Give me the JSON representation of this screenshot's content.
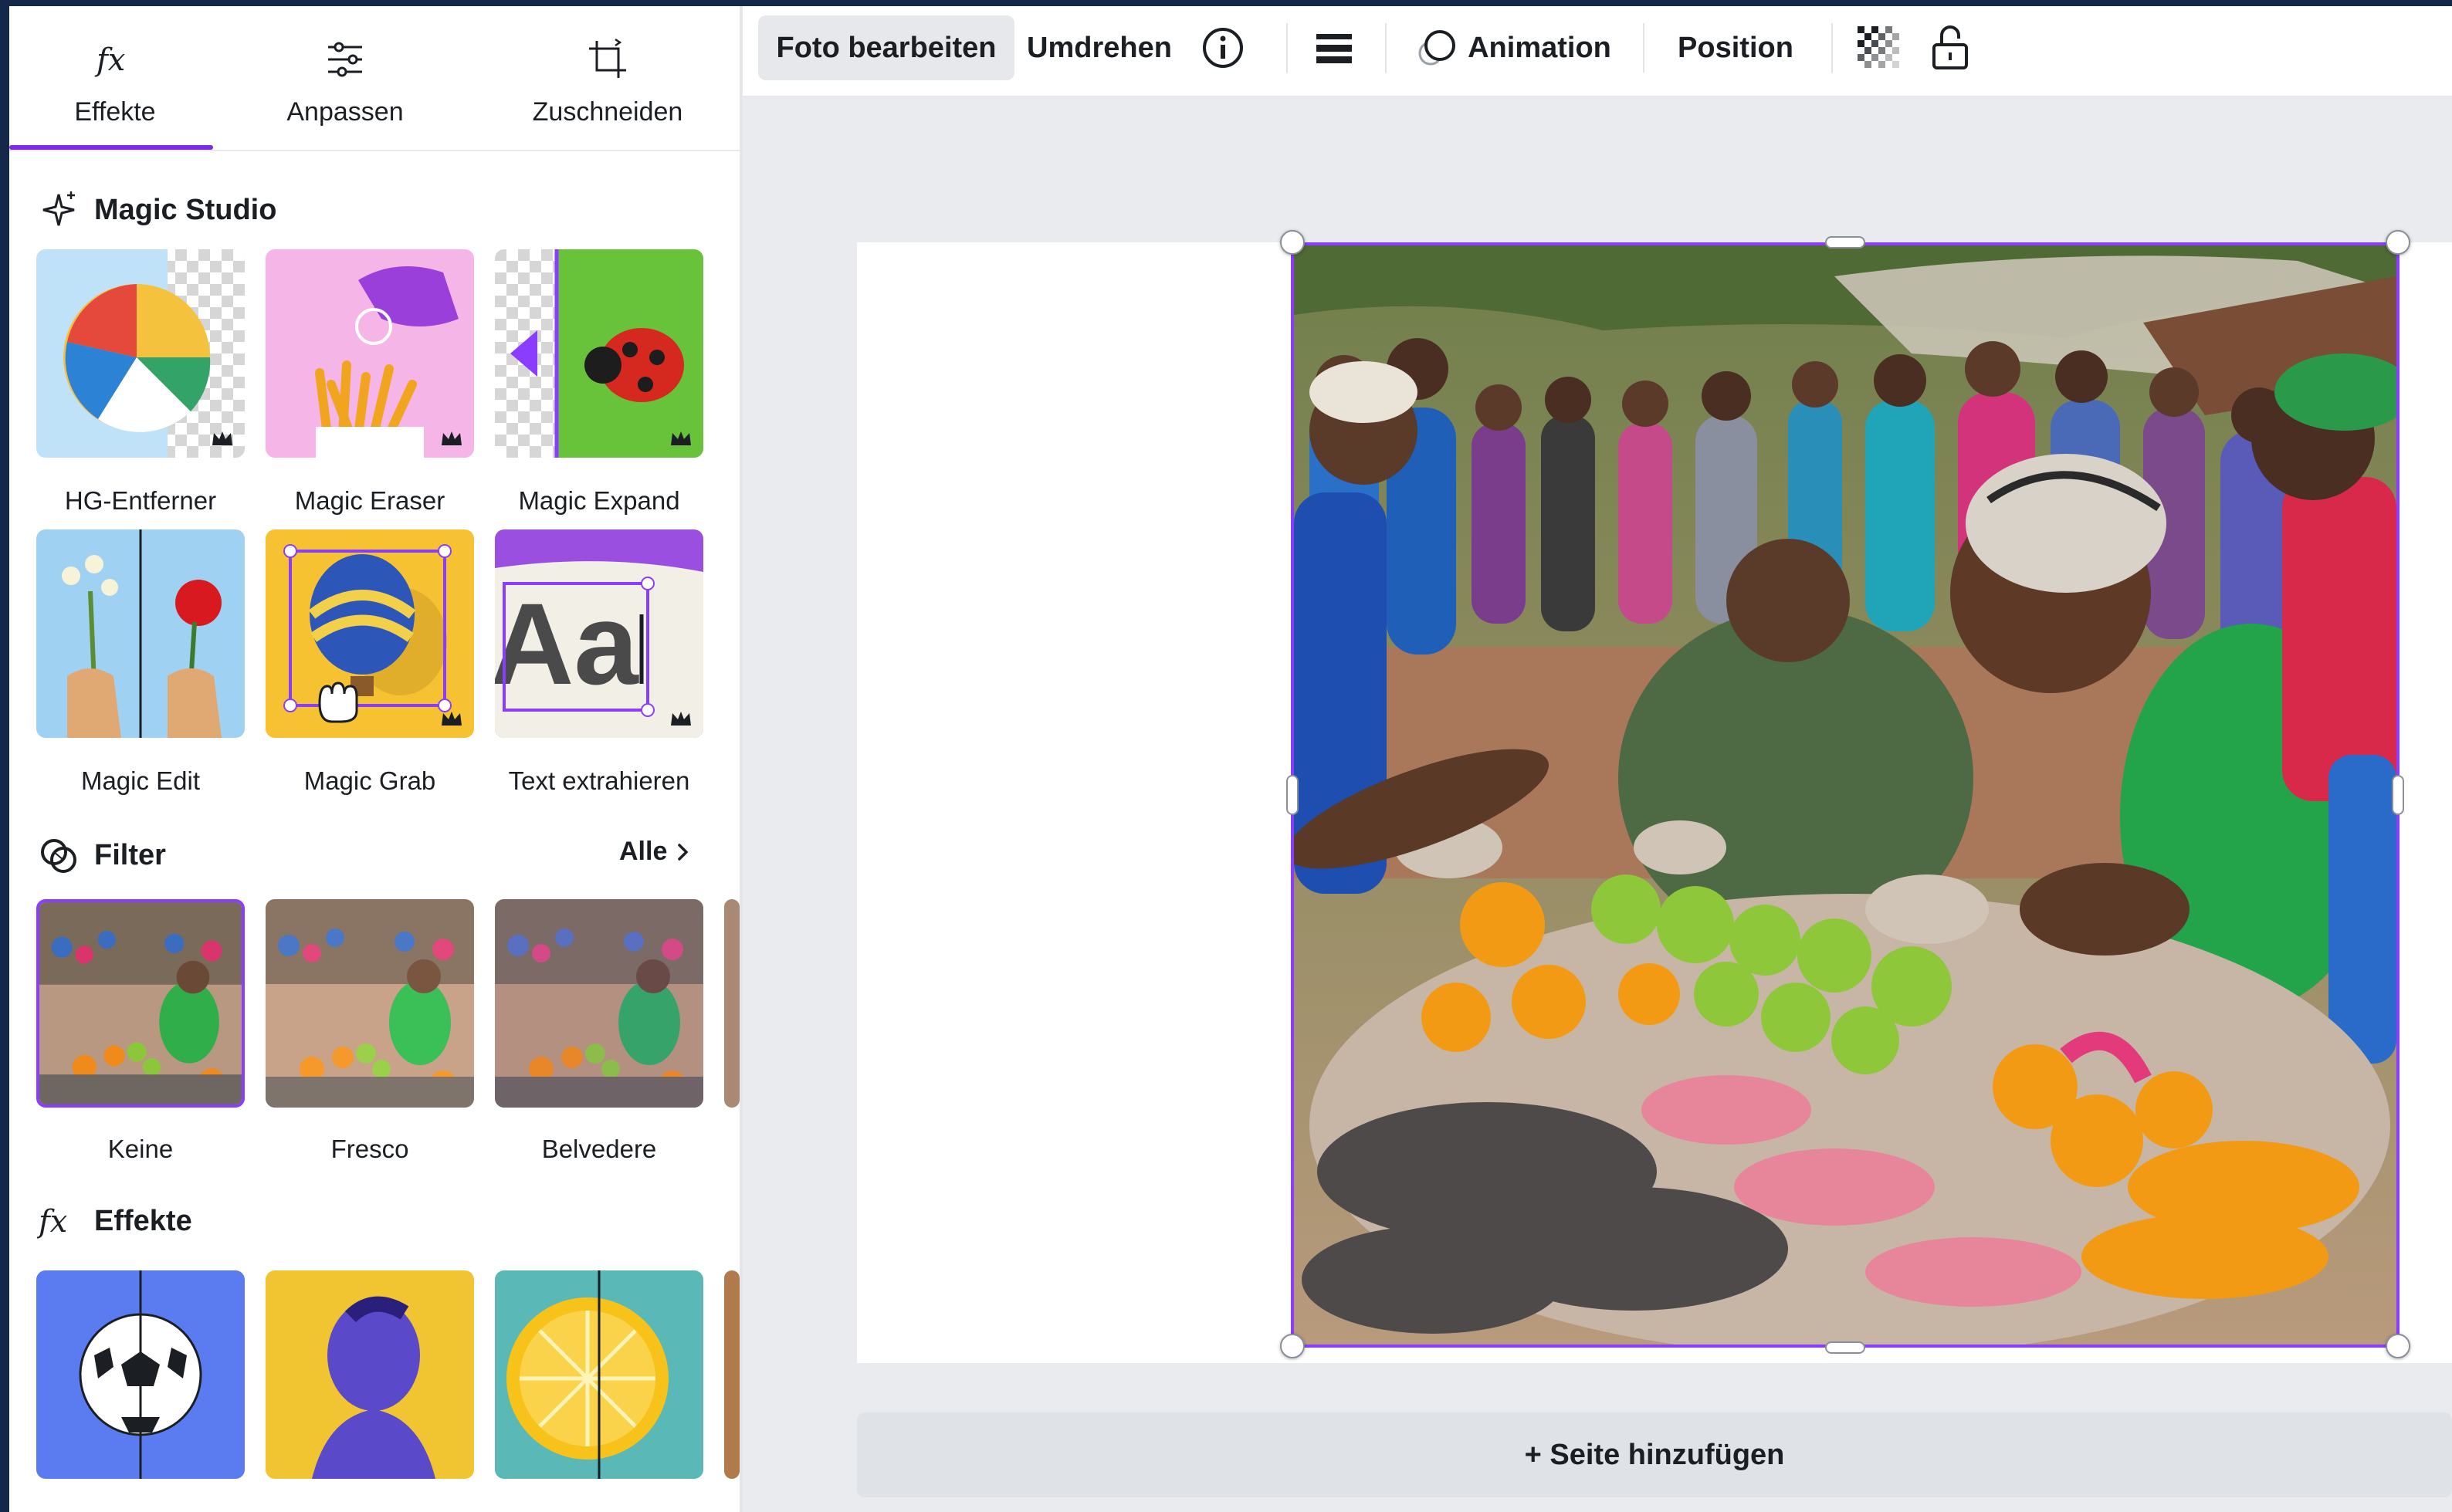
{
  "tabs": [
    {
      "label": "Effekte",
      "icon": "fx-icon",
      "active": true
    },
    {
      "label": "Anpassen",
      "icon": "sliders-icon"
    },
    {
      "label": "Zuschneiden",
      "icon": "crop-icon"
    }
  ],
  "magic_studio": {
    "title": "Magic Studio",
    "tools": [
      {
        "label": "HG-Entferner",
        "premium": true
      },
      {
        "label": "Magic Eraser",
        "premium": true
      },
      {
        "label": "Magic Expand",
        "premium": true
      },
      {
        "label": "Magic Edit"
      },
      {
        "label": "Magic Grab",
        "premium": true
      },
      {
        "label": "Text extrahieren",
        "premium": true
      }
    ]
  },
  "filter": {
    "title": "Filter",
    "all_label": "Alle",
    "items": [
      {
        "label": "Keine",
        "selected": true
      },
      {
        "label": "Fresco"
      },
      {
        "label": "Belvedere"
      }
    ]
  },
  "effects": {
    "title": "Effekte"
  },
  "toolbar": {
    "edit_photo": "Foto bearbeiten",
    "flip": "Umdrehen",
    "animation": "Animation",
    "position": "Position"
  },
  "canvas": {
    "add_page": "+ Seite hinzufügen"
  },
  "colors": {
    "accent": "#7d2ae8",
    "selection": "#8b3dff",
    "frame": "#14284a"
  }
}
